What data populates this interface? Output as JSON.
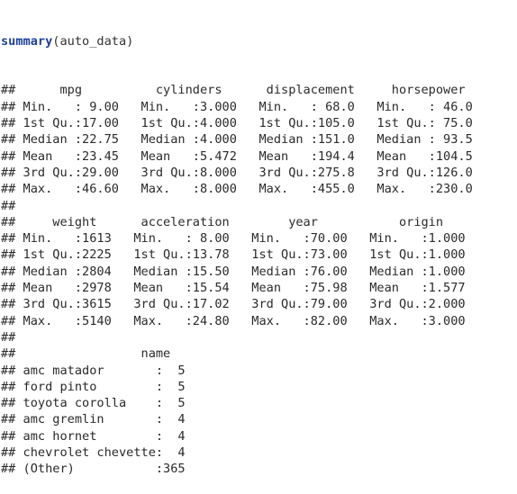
{
  "command": {
    "function": "summary",
    "args": "(auto_data)"
  },
  "output_prefix": "##",
  "output_lines": [
    "      mpg          cylinders      displacement     horsepower    ",
    " Min.   : 9.00   Min.   :3.000   Min.   : 68.0   Min.   : 46.0  ",
    " 1st Qu.:17.00   1st Qu.:4.000   1st Qu.:105.0   1st Qu.: 75.0  ",
    " Median :22.75   Median :4.000   Median :151.0   Median : 93.5  ",
    " Mean   :23.45   Mean   :5.472   Mean   :194.4   Mean   :104.5  ",
    " 3rd Qu.:29.00   3rd Qu.:8.000   3rd Qu.:275.8   3rd Qu.:126.0  ",
    " Max.   :46.60   Max.   :8.000   Max.   :455.0   Max.   :230.0  ",
    "",
    "     weight      acceleration        year           origin     ",
    " Min.   :1613   Min.   : 8.00   Min.   :70.00   Min.   :1.000  ",
    " 1st Qu.:2225   1st Qu.:13.78   1st Qu.:73.00   1st Qu.:1.000  ",
    " Median :2804   Median :15.50   Median :76.00   Median :1.000  ",
    " Mean   :2978   Mean   :15.54   Mean   :75.98   Mean   :1.577  ",
    " 3rd Qu.:3615   3rd Qu.:17.02   3rd Qu.:79.00   3rd Qu.:2.000  ",
    " Max.   :5140   Max.   :24.80   Max.   :82.00   Max.   :3.000  ",
    "",
    "                 name    ",
    " amc matador       :  5  ",
    " ford pinto        :  5  ",
    " toyota corolla    :  5  ",
    " amc gremlin       :  4  ",
    " amc hornet        :  4  ",
    " chevrolet chevette:  4  ",
    " (Other)           :365  "
  ]
}
